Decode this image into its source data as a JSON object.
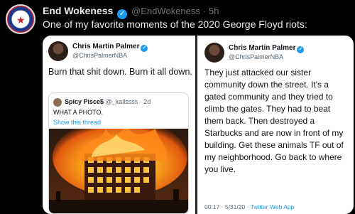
{
  "tweet": {
    "author_name": "End Wokeness",
    "author_handle": "@EndWokeness",
    "separator": "·",
    "time": "5h",
    "text": "One of my favorite moments of the 2020 George Floyd riots:"
  },
  "left_screenshot": {
    "author_name": "Chris Martin Palmer",
    "author_handle": "@ChrisPalmerNBA",
    "body": "Burn that shit down. Burn it all down.",
    "quote": {
      "author_name": "Spicy Pisce$",
      "author_handle": "@_kailssss · 2d",
      "text": "WHAT A PHOTO.",
      "link": "Show this thread"
    }
  },
  "right_screenshot": {
    "author_name": "Chris Martin Palmer",
    "author_handle": "@ChrisPalmerNBA",
    "body": "They just attacked our sister community down the street. It's a gated community and they tried to climb the gates. They had to beat them back. Then destroyed a Starbucks and are now in front of my building. Get these animals TF out of my neighborhood. Go back to where you live.",
    "meta_time": "00:17 · 5/31/20 · ",
    "meta_source": "Twitter Web App"
  },
  "colors": {
    "background": "#000000",
    "verified": "#1d9bf0",
    "link": "#1d9bf0"
  },
  "icons": {
    "verified": "verified-badge-icon"
  }
}
